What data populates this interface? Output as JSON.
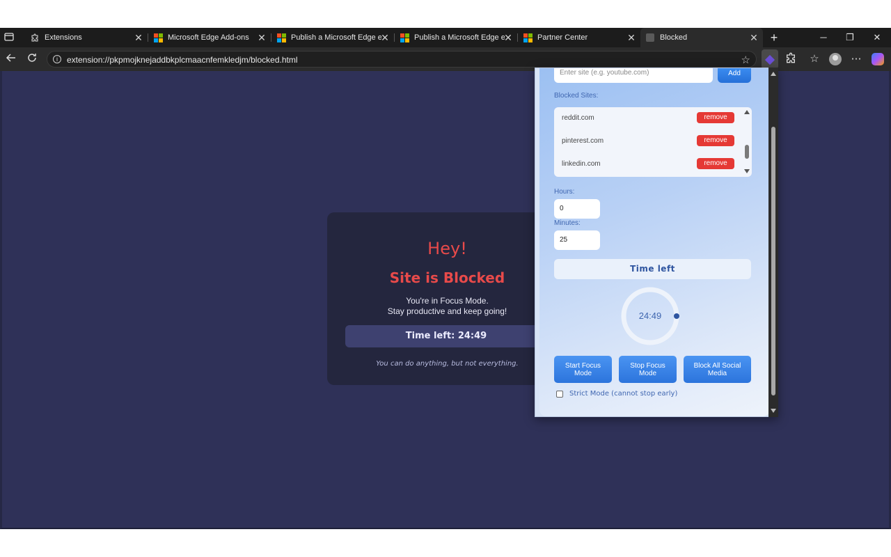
{
  "browser": {
    "tabs": [
      {
        "title": "Extensions",
        "icon": "puzzle-icon"
      },
      {
        "title": "Microsoft Edge Add-ons",
        "icon": "microsoft-logo-icon"
      },
      {
        "title": "Publish a Microsoft Edge ext",
        "icon": "microsoft-logo-icon"
      },
      {
        "title": "Publish a Microsoft Edge ext",
        "icon": "microsoft-logo-icon"
      },
      {
        "title": "Partner Center",
        "icon": "microsoft-logo-icon"
      },
      {
        "title": "Blocked",
        "icon": "page-icon"
      }
    ],
    "close_glyph": "✕",
    "new_tab_glyph": "+",
    "window_buttons": {
      "minimize": "─",
      "restore": "❐",
      "close": "✕"
    },
    "url": "extension://pkpmojknejaddbkplcmaacnfemkledjm/blocked.html"
  },
  "blocked_page": {
    "greeting": "Hey!",
    "title": "Site is Blocked",
    "message_line1": "You're in Focus Mode.",
    "message_line2": "Stay productive and keep going!",
    "timer": "Time left: 24:49",
    "quote": "You can do anything, but not everything.",
    "accent_color": "#e84a4a",
    "background_color": "#2f3158"
  },
  "popup": {
    "site_input_placeholder": "Enter site (e.g. youtube.com)",
    "add_label": "Add",
    "blocked_sites_label": "Blocked Sites:",
    "blocked_sites": [
      {
        "site": "reddit.com",
        "action": "remove"
      },
      {
        "site": "pinterest.com",
        "action": "remove"
      },
      {
        "site": "linkedin.com",
        "action": "remove"
      }
    ],
    "hours_label": "Hours:",
    "hours_value": "0",
    "minutes_label": "Minutes:",
    "minutes_value": "25",
    "time_left_label": "Time left",
    "ring_time": "24:49",
    "ring_progress": 0.993,
    "buttons": {
      "start": "Start Focus Mode",
      "stop": "Stop Focus Mode",
      "block_all": "Block All Social Media"
    },
    "strict_mode_label": "Strict Mode (cannot stop early)",
    "strict_mode_checked": false,
    "remove_color": "#e53935",
    "button_color": "#2c74dc"
  }
}
